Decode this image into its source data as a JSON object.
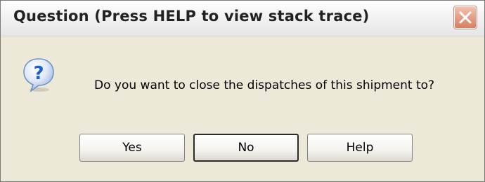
{
  "dialog": {
    "title": "Question (Press HELP to view stack trace)",
    "close_icon": "close-icon",
    "question_icon": "question-icon",
    "message": "Do you want to close the dispatches of this shipment to?",
    "buttons": {
      "yes": "Yes",
      "no": "No",
      "help": "Help"
    },
    "colors": {
      "window_bg": "#ece9d8",
      "close_button": "#e49b83",
      "icon_blue": "#2f6fd0"
    }
  }
}
